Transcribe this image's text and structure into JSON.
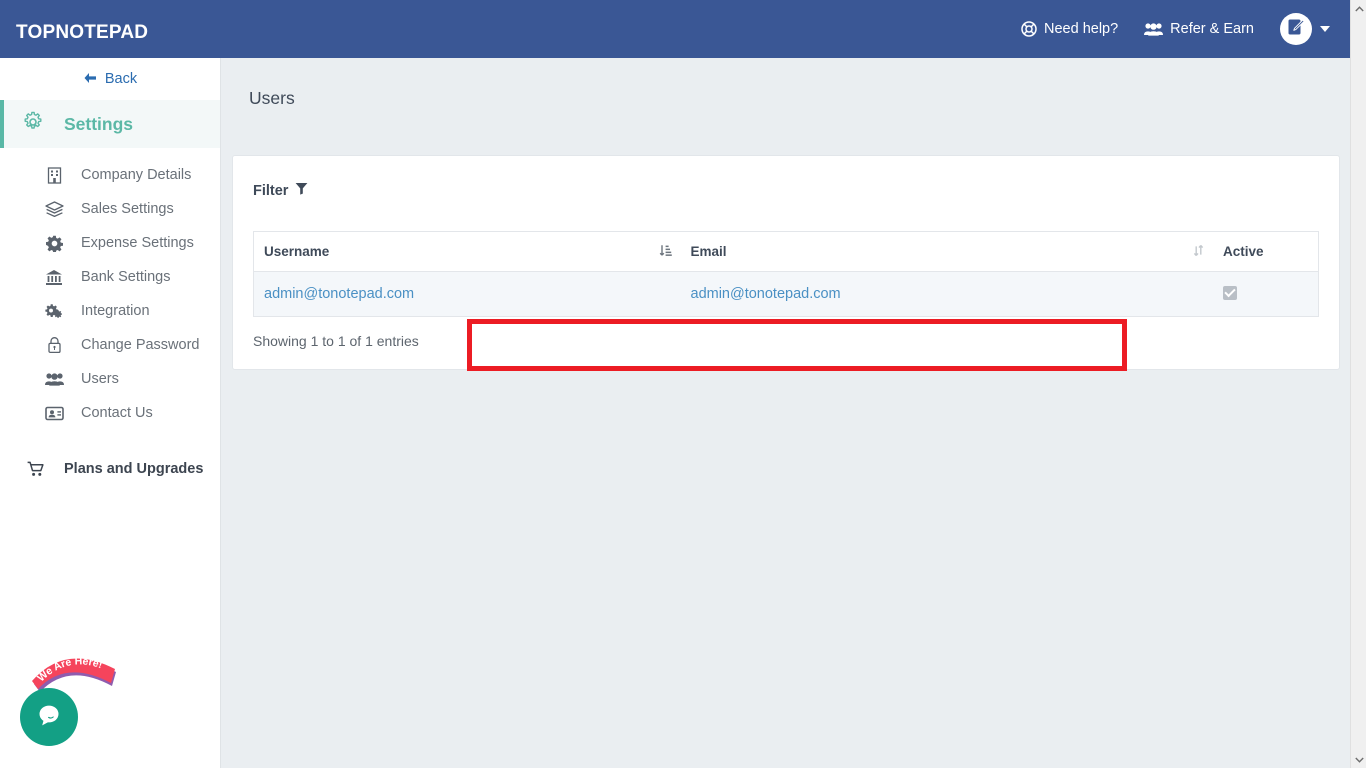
{
  "header": {
    "brand": "TopNotepad",
    "need_help": "Need help?",
    "need_help_icon": "life-ring-icon",
    "refer_earn": "Refer & Earn",
    "refer_earn_icon": "users-icon",
    "avatar_icon": "edit-note-icon",
    "caret_icon": "caret-down-icon",
    "bg_color": "#3a5795"
  },
  "sidebar": {
    "back_label": "Back",
    "back_icon": "arrow-left-icon",
    "section_title": "Settings",
    "section_icon": "gear-icon",
    "accent_color": "#59b8a6",
    "items": [
      {
        "label": "Company Details",
        "icon": "building-icon"
      },
      {
        "label": "Sales Settings",
        "icon": "layers-icon"
      },
      {
        "label": "Expense Settings",
        "icon": "cog-icon"
      },
      {
        "label": "Bank Settings",
        "icon": "bank-icon"
      },
      {
        "label": "Integration",
        "icon": "cogs-icon"
      },
      {
        "label": "Change Password",
        "icon": "lock-icon"
      },
      {
        "label": "Users",
        "icon": "users-icon"
      },
      {
        "label": "Contact Us",
        "icon": "id-card-icon"
      }
    ],
    "plans": {
      "label": "Plans and Upgrades",
      "icon": "shopping-cart-icon"
    }
  },
  "main": {
    "page_title": "Users",
    "filter_label": "Filter",
    "filter_icon": "funnel-icon",
    "table": {
      "columns": [
        {
          "label": "Username",
          "sort_icon": "sort-amount-asc-icon",
          "sorted": true
        },
        {
          "label": "Email",
          "sort_icon": "sort-icon",
          "sorted": false
        },
        {
          "label": "Active",
          "sort_icon": "",
          "sorted": false
        }
      ],
      "rows": [
        {
          "username": "admin@tonotepad.com",
          "email": "admin@tonotepad.com",
          "active": true,
          "active_icon": "checkbox-checked-disabled-icon"
        }
      ]
    },
    "entries_info": "Showing 1 to 1 of 1 entries",
    "highlight_color": "#ec1c24"
  },
  "chat": {
    "banner_text": "We Are Here!",
    "banner_color": "#f5445c",
    "button_color": "#13a085",
    "button_icon": "chat-bubble-icon"
  },
  "scrollbar": {
    "up_icon": "chevron-up-icon",
    "down_icon": "chevron-down-icon"
  }
}
